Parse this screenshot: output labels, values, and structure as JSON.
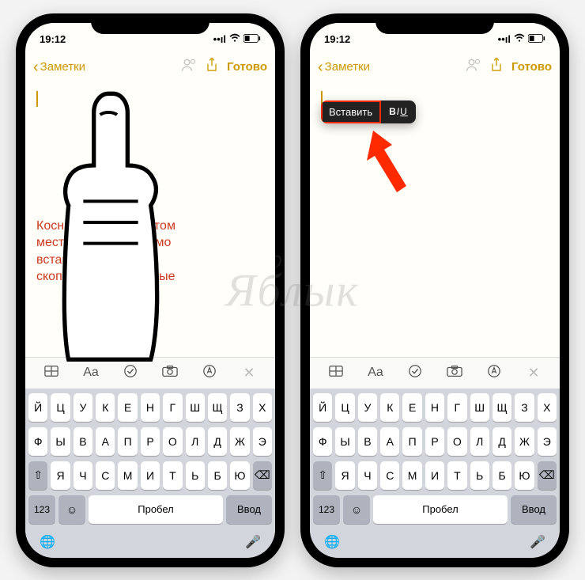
{
  "watermark": "ЯБЛЫК",
  "status": {
    "time": "19:12"
  },
  "nav": {
    "back": "Заметки",
    "done": "Готово"
  },
  "left": {
    "annotation": "Коснитесь экрана в том месте, где необходимо вставить скопированные данные"
  },
  "right": {
    "menu": {
      "paste": "Вставить",
      "biu_b": "B",
      "biu_i": "I",
      "biu_u": "U"
    }
  },
  "toolbar": {
    "aa": "Aa"
  },
  "keyboard": {
    "row1": [
      "Й",
      "Ц",
      "У",
      "К",
      "Е",
      "Н",
      "Г",
      "Ш",
      "Щ",
      "З",
      "Х"
    ],
    "row2": [
      "Ф",
      "Ы",
      "В",
      "А",
      "П",
      "Р",
      "О",
      "Л",
      "Д",
      "Ж",
      "Э"
    ],
    "row3": [
      "Я",
      "Ч",
      "С",
      "М",
      "И",
      "Т",
      "Ь",
      "Б",
      "Ю"
    ],
    "num": "123",
    "space": "Пробел",
    "enter": "Ввод"
  }
}
